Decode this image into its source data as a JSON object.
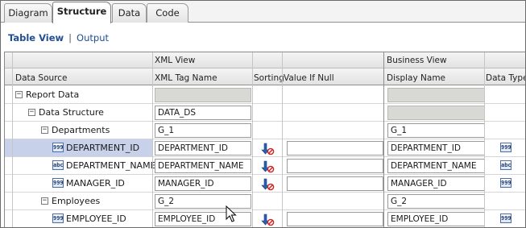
{
  "tabs": [
    {
      "label": "Diagram",
      "active": false
    },
    {
      "label": "Structure",
      "active": true
    },
    {
      "label": "Data",
      "active": false
    },
    {
      "label": "Code",
      "active": false
    }
  ],
  "views": {
    "table_view": "Table View",
    "separator": "|",
    "output": "Output"
  },
  "grid": {
    "group_headers": {
      "xml_view": "XML View",
      "business_view": "Business View"
    },
    "columns": {
      "data_source": "Data Source",
      "xml_tag_name": "XML Tag Name",
      "sorting": "Sorting",
      "value_if_null": "Value If Null",
      "display_name": "Display Name",
      "data_type": "Data Type"
    },
    "rows": [
      {
        "label": "Report Data",
        "kind": "node",
        "expander": "−",
        "xml_tag": "",
        "display_name": ""
      },
      {
        "label": "Data Structure",
        "kind": "node",
        "expander": "−",
        "xml_tag": "DATA_DS",
        "display_name": ""
      },
      {
        "label": "Departments",
        "kind": "node",
        "expander": "−",
        "xml_tag": "G_1",
        "display_name": "G_1"
      },
      {
        "label": "DEPARTMENT_ID",
        "kind": "element",
        "type_icon": "999",
        "xml_tag": "DEPARTMENT_ID",
        "value_if_null": "",
        "display_name": "DEPARTMENT_ID",
        "data_type_icon": "999",
        "selected": true
      },
      {
        "label": "DEPARTMENT_NAME",
        "kind": "element",
        "type_icon": "abc",
        "xml_tag": "DEPARTMENT_NAME",
        "value_if_null": "",
        "display_name": "DEPARTMENT_NAME",
        "data_type_icon": "abc"
      },
      {
        "label": "MANAGER_ID",
        "kind": "element",
        "type_icon": "999",
        "xml_tag": "MANAGER_ID",
        "value_if_null": "",
        "display_name": "MANAGER_ID",
        "data_type_icon": "999"
      },
      {
        "label": "Employees",
        "kind": "node",
        "expander": "−",
        "xml_tag": "G_2",
        "display_name": "G_2"
      },
      {
        "label": "EMPLOYEE_ID",
        "kind": "element",
        "type_icon": "999",
        "xml_tag": "EMPLOYEE_ID",
        "value_if_null": "",
        "display_name": "EMPLOYEE_ID",
        "data_type_icon": "999"
      }
    ]
  },
  "icons": {
    "sort": "sort-ascending-icon",
    "number_type": "number-type-icon",
    "text_type": "text-type-icon",
    "expander": "collapse-icon"
  },
  "colors": {
    "selected_row": "#c7d2ea",
    "link": "#1f4e93",
    "disabled_field": "#d8d8d4",
    "sort_arrow": "#2b5fb3",
    "sort_badge": "#cc2222"
  }
}
